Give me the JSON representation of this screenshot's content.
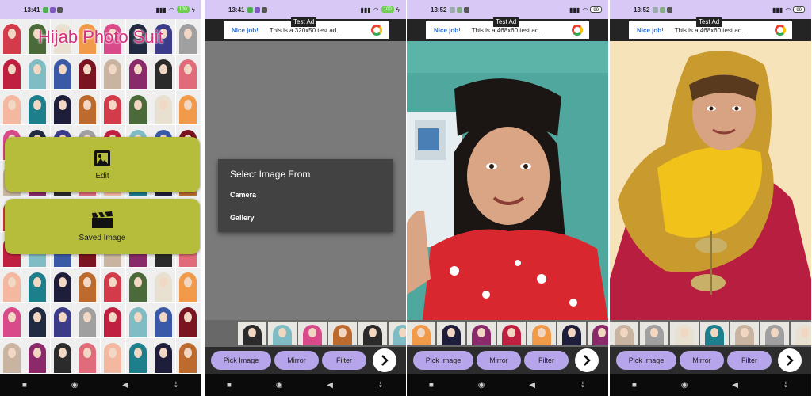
{
  "screen1": {
    "status": {
      "time": "13:41",
      "battery": "100"
    },
    "app_title": "Hijab Photo Suit",
    "buttons": {
      "edit": "Edit",
      "saved": "Saved Image"
    }
  },
  "screen2": {
    "status": {
      "time": "13:41",
      "battery": "100"
    },
    "ad": {
      "tag": "Test Ad",
      "nice": "Nice job!",
      "message": "This is a 320x50 test ad."
    },
    "dialog": {
      "title": "Select Image From",
      "options": [
        "Camera",
        "Gallery"
      ]
    },
    "controls": {
      "pick": "Pick Image",
      "mirror": "Mirror",
      "filter": "Filter"
    }
  },
  "screen3": {
    "status": {
      "time": "13:52",
      "battery": "99"
    },
    "ad": {
      "tag": "Test Ad",
      "nice": "Nice job!",
      "message": "This is a 468x60 test ad."
    },
    "controls": {
      "pick": "Pick Image",
      "mirror": "Mirror",
      "filter": "Filter"
    }
  },
  "screen4": {
    "status": {
      "time": "13:52",
      "battery": "99"
    },
    "ad": {
      "tag": "Test Ad",
      "nice": "Nice job!",
      "message": "This is a 468x60 test ad."
    },
    "controls": {
      "pick": "Pick Image",
      "mirror": "Mirror",
      "filter": "Filter"
    }
  },
  "colors": {
    "status_bar": "#d7c8f6",
    "button_olive": "#b6bd3a",
    "pill_purple": "#b6a5ea",
    "title_pink": "#d5307e",
    "dialog_bg": "#424242"
  },
  "icons": [
    "image-icon",
    "clapperboard-icon",
    "chevron-right-icon",
    "wifi-icon",
    "signal-icon",
    "battery-icon",
    "home-nav-icon",
    "back-nav-icon",
    "recents-nav-icon",
    "ad-choices-icon"
  ]
}
